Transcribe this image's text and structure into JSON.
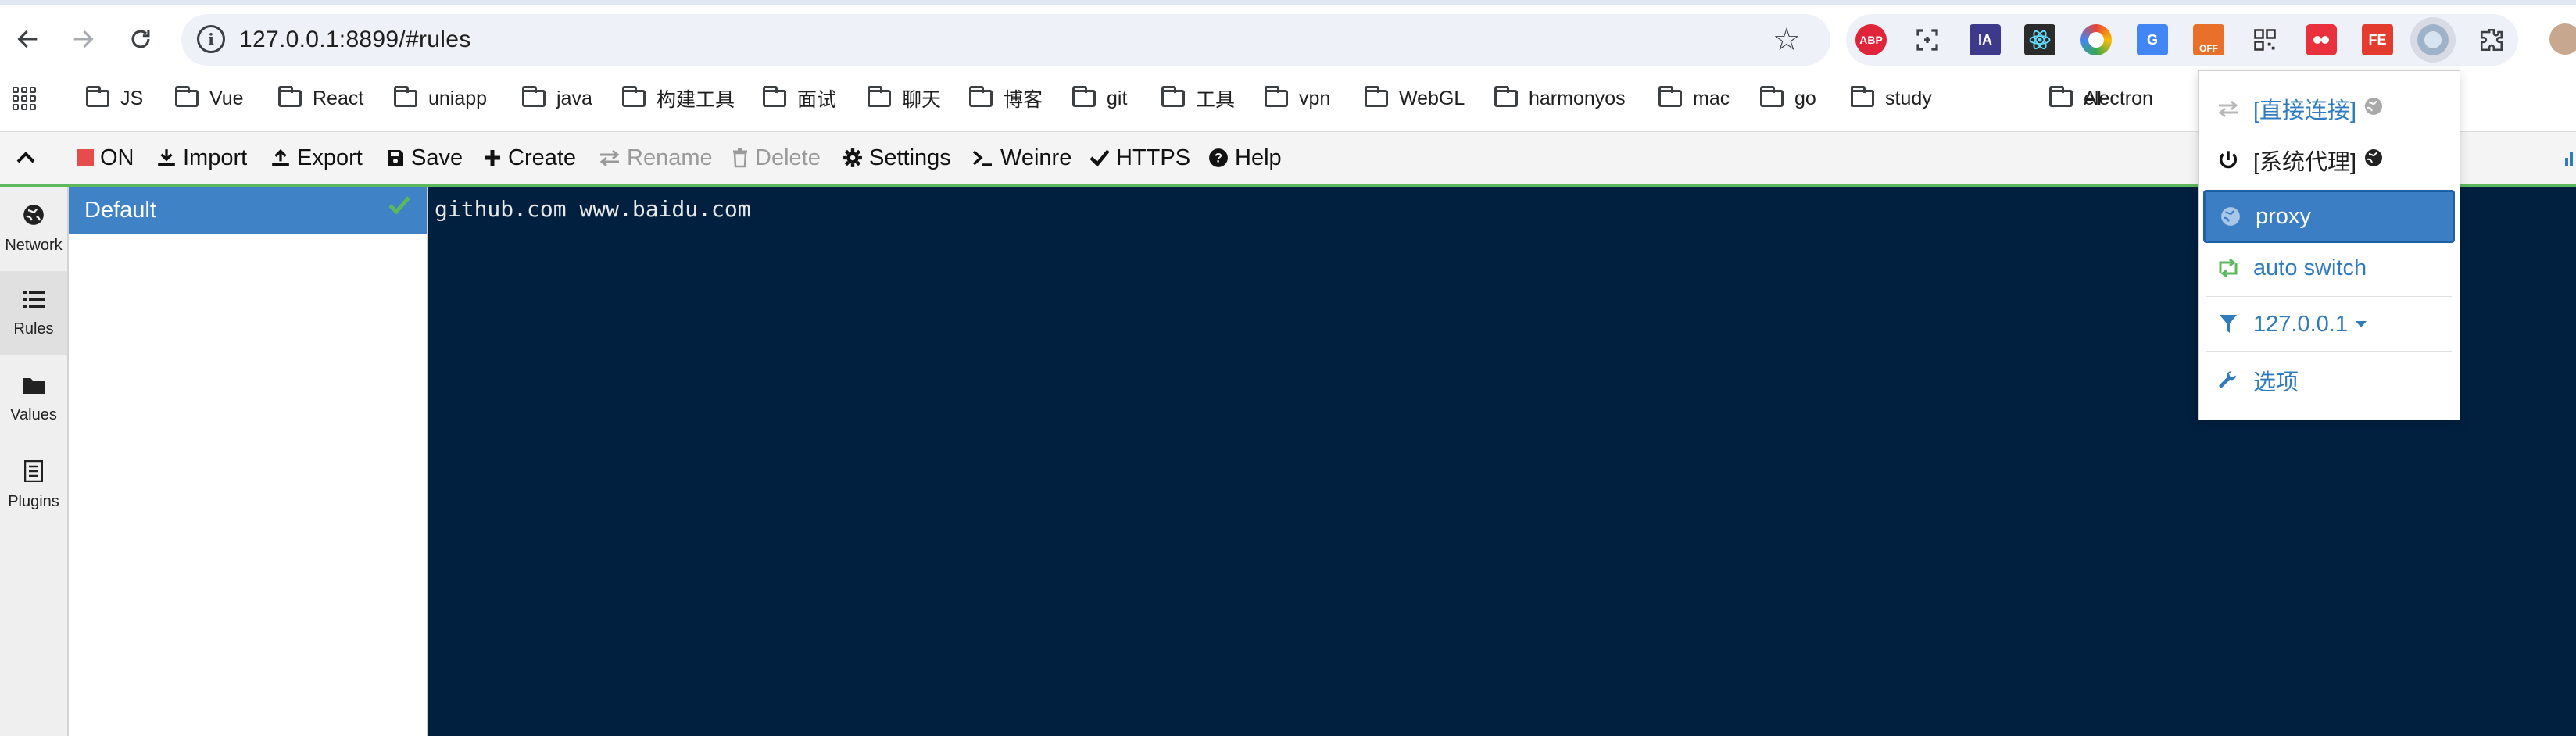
{
  "browser": {
    "url": "127.0.0.1:8899/#rules",
    "extensions": [
      "ABP",
      "",
      "IA",
      "",
      "",
      "",
      "OFF",
      "",
      "",
      "FE",
      "",
      ""
    ],
    "colors": {
      "accent": "#3f82c6",
      "editor_bg": "#011f3f",
      "success": "#5cb85c"
    }
  },
  "bookmarks": [
    "JS",
    "Vue",
    "React",
    "uniapp",
    "java",
    "构建工具",
    "面试",
    "聊天",
    "博客",
    "git",
    "工具",
    "vpn",
    "WebGL",
    "harmonyos",
    "mac",
    "go",
    "study",
    "AI",
    "electron"
  ],
  "toolbar": {
    "on": "ON",
    "import": "Import",
    "export": "Export",
    "save": "Save",
    "create": "Create",
    "rename": "Rename",
    "delete": "Delete",
    "settings": "Settings",
    "weinre": "Weinre",
    "https": "HTTPS",
    "help": "Help"
  },
  "leftnav": {
    "network": "Network",
    "rules": "Rules",
    "values": "Values",
    "plugins": "Plugins"
  },
  "rules": {
    "items": [
      {
        "name": "Default"
      }
    ]
  },
  "editor": {
    "content": "github.com www.baidu.com"
  },
  "popup": {
    "direct": "[直接连接]",
    "system": "[系统代理]",
    "proxy": "proxy",
    "auto_switch": "auto switch",
    "server": "127.0.0.1",
    "options": "选项"
  }
}
